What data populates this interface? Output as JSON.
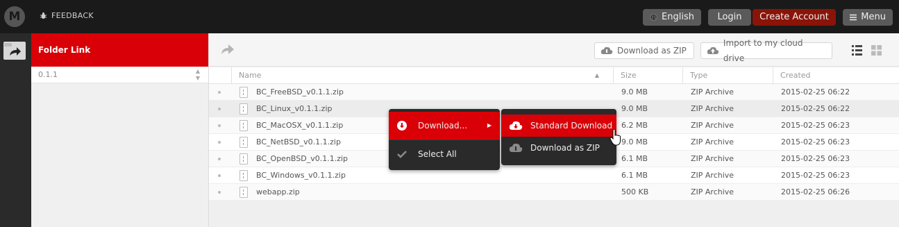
{
  "topbar": {
    "logo_letter": "M",
    "feedback_label": "FEEDBACK",
    "language_label": "English",
    "login_label": "Login",
    "create_account_label": "Create Account",
    "menu_label": "Menu"
  },
  "sidebar": {
    "folder_link_label": "Folder Link",
    "folder_item": "0.1.1"
  },
  "toolbar": {
    "download_zip_label": "Download as ZIP",
    "import_label": "Import to my cloud drive"
  },
  "table": {
    "headers": {
      "name": "Name",
      "size": "Size",
      "type": "Type",
      "created": "Created"
    },
    "rows": [
      {
        "name": "BC_FreeBSD_v0.1.1.zip",
        "size": "9.0 MB",
        "type": "ZIP Archive",
        "created": "2015-02-25 06:22"
      },
      {
        "name": "BC_Linux_v0.1.1.zip",
        "size": "9.0 MB",
        "type": "ZIP Archive",
        "created": "2015-02-25 06:22"
      },
      {
        "name": "BC_MacOSX_v0.1.1.zip",
        "size": "6.2 MB",
        "type": "ZIP Archive",
        "created": "2015-02-25 06:23"
      },
      {
        "name": "BC_NetBSD_v0.1.1.zip",
        "size": "9.0 MB",
        "type": "ZIP Archive",
        "created": "2015-02-25 06:23"
      },
      {
        "name": "BC_OpenBSD_v0.1.1.zip",
        "size": "6.1 MB",
        "type": "ZIP Archive",
        "created": "2015-02-25 06:23"
      },
      {
        "name": "BC_Windows_v0.1.1.zip",
        "size": "6.1 MB",
        "type": "ZIP Archive",
        "created": "2015-02-25 06:23"
      },
      {
        "name": "webapp.zip",
        "size": "500 KB",
        "type": "ZIP Archive",
        "created": "2015-02-25 06:26"
      }
    ]
  },
  "context_menu": {
    "download_label": "Download...",
    "select_all_label": "Select All"
  },
  "submenu": {
    "standard_download_label": "Standard Download",
    "download_zip_label": "Download as ZIP"
  },
  "colors": {
    "brand_red": "#d90007",
    "create_account_bg": "#8a1408",
    "topbar_bg": "#1a1a1a",
    "menu_bg": "#2a2a2a"
  }
}
